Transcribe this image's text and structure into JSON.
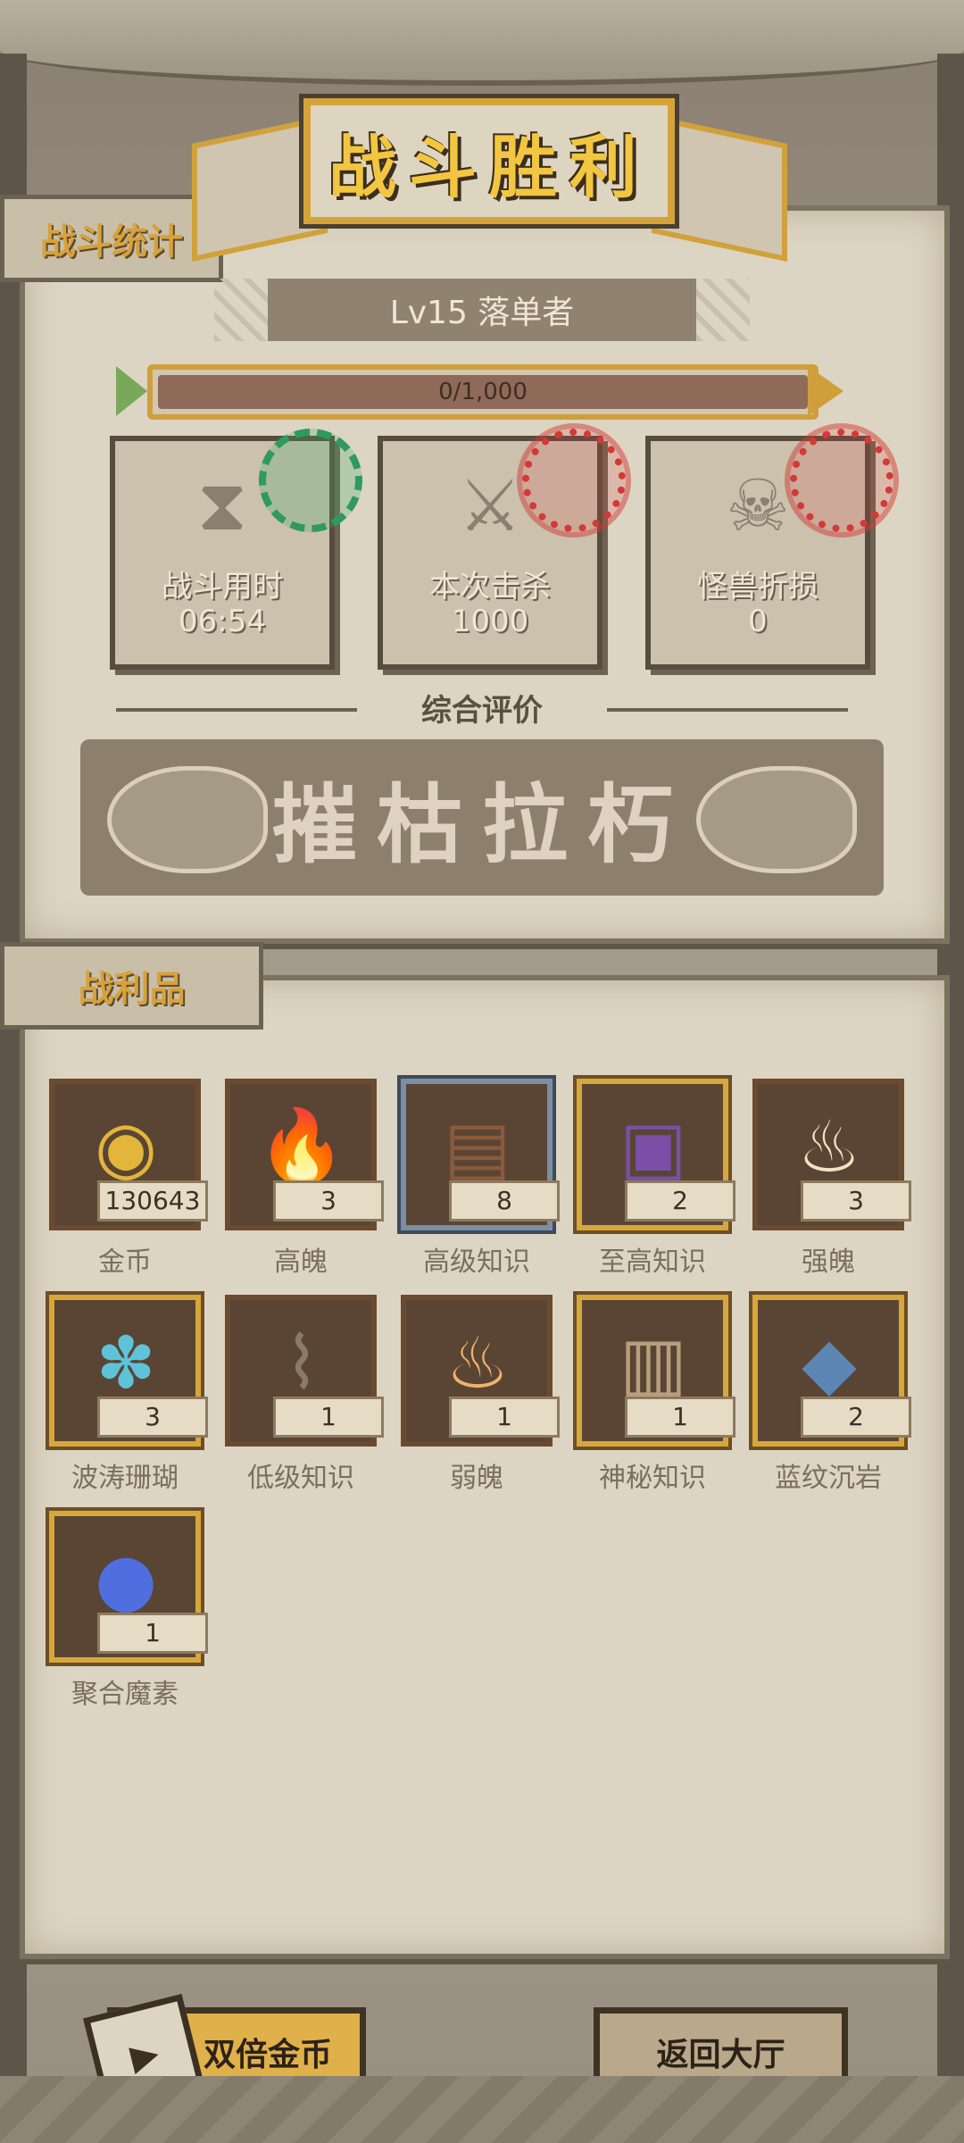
{
  "title": "战斗胜利",
  "sections": {
    "stats_tab": "战斗统计",
    "loot_tab": "战利品"
  },
  "level": {
    "label": "Lv15 落单者"
  },
  "xp": {
    "text": "0/1,000",
    "current": 0,
    "max": 1000
  },
  "stats": [
    {
      "label": "战斗用时",
      "value": "06:54",
      "icon": "hourglass-icon",
      "stamp": "绿色徽章"
    },
    {
      "label": "本次击杀",
      "value": "1000",
      "icon": "crossed-swords-icon",
      "stamp": "红色徽章"
    },
    {
      "label": "怪兽折损",
      "value": "0",
      "icon": "horned-skull-icon",
      "stamp": "红色徽章"
    }
  ],
  "rating": {
    "label": "综合评价",
    "value": "摧枯拉朽"
  },
  "loot": [
    {
      "name": "金币",
      "count": "130643",
      "icon": "gold-coin-icon",
      "frame": "brown"
    },
    {
      "name": "高魄",
      "count": "3",
      "icon": "orange-flame-icon",
      "frame": "brown"
    },
    {
      "name": "高级知识",
      "count": "8",
      "icon": "book-icon",
      "frame": "blue"
    },
    {
      "name": "至高知识",
      "count": "2",
      "icon": "purple-tome-icon",
      "frame": "gold"
    },
    {
      "name": "强魄",
      "count": "3",
      "icon": "white-flame-icon",
      "frame": "brown"
    },
    {
      "name": "波涛珊瑚",
      "count": "3",
      "icon": "coral-icon",
      "frame": "gold"
    },
    {
      "name": "低级知识",
      "count": "1",
      "icon": "scroll-icon",
      "frame": "brown"
    },
    {
      "name": "弱魄",
      "count": "1",
      "icon": "small-flame-icon",
      "frame": "brown"
    },
    {
      "name": "神秘知识",
      "count": "1",
      "icon": "stone-tablet-icon",
      "frame": "gold"
    },
    {
      "name": "蓝纹沉岩",
      "count": "2",
      "icon": "blue-rock-icon",
      "frame": "gold"
    },
    {
      "name": "聚合魔素",
      "count": "1",
      "icon": "magic-orb-icon",
      "frame": "gold"
    }
  ],
  "buttons": {
    "double_coin": "双倍金币",
    "return_lobby": "返回大厅"
  },
  "colors": {
    "accent_gold": "#d4a43b",
    "parchment": "#ddd5c3",
    "xp_track": "#8f6a58",
    "stamp_green": "#2f9a5c",
    "stamp_red": "#d23a36"
  }
}
